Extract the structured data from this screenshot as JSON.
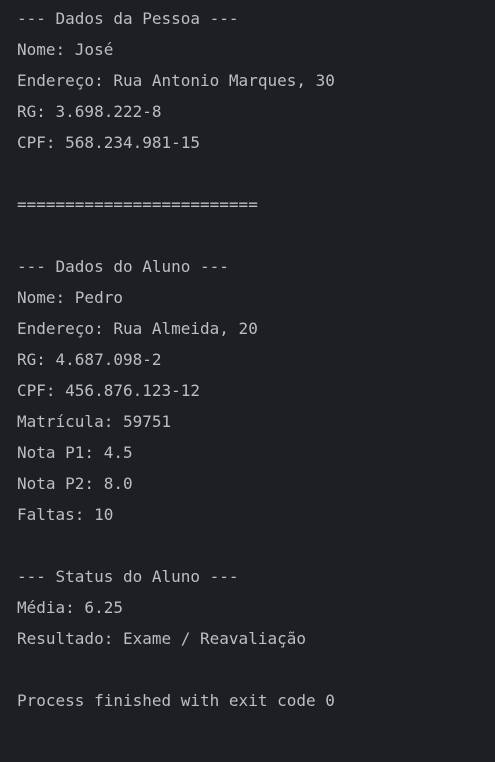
{
  "console": {
    "lines": [
      "--- Dados da Pessoa ---",
      "Nome: José",
      "Endereço: Rua Antonio Marques, 30",
      "RG: 3.698.222-8",
      "CPF: 568.234.981-15",
      "",
      "=========================",
      "",
      "--- Dados do Aluno ---",
      "Nome: Pedro",
      "Endereço: Rua Almeida, 20",
      "RG: 4.687.098-2",
      "CPF: 456.876.123-12",
      "Matrícula: 59751",
      "Nota P1: 4.5",
      "Nota P2: 8.0",
      "Faltas: 10",
      "",
      "--- Status do Aluno ---",
      "Média: 6.25",
      "Resultado: Exame / Reavaliação",
      "",
      "Process finished with exit code 0"
    ]
  }
}
